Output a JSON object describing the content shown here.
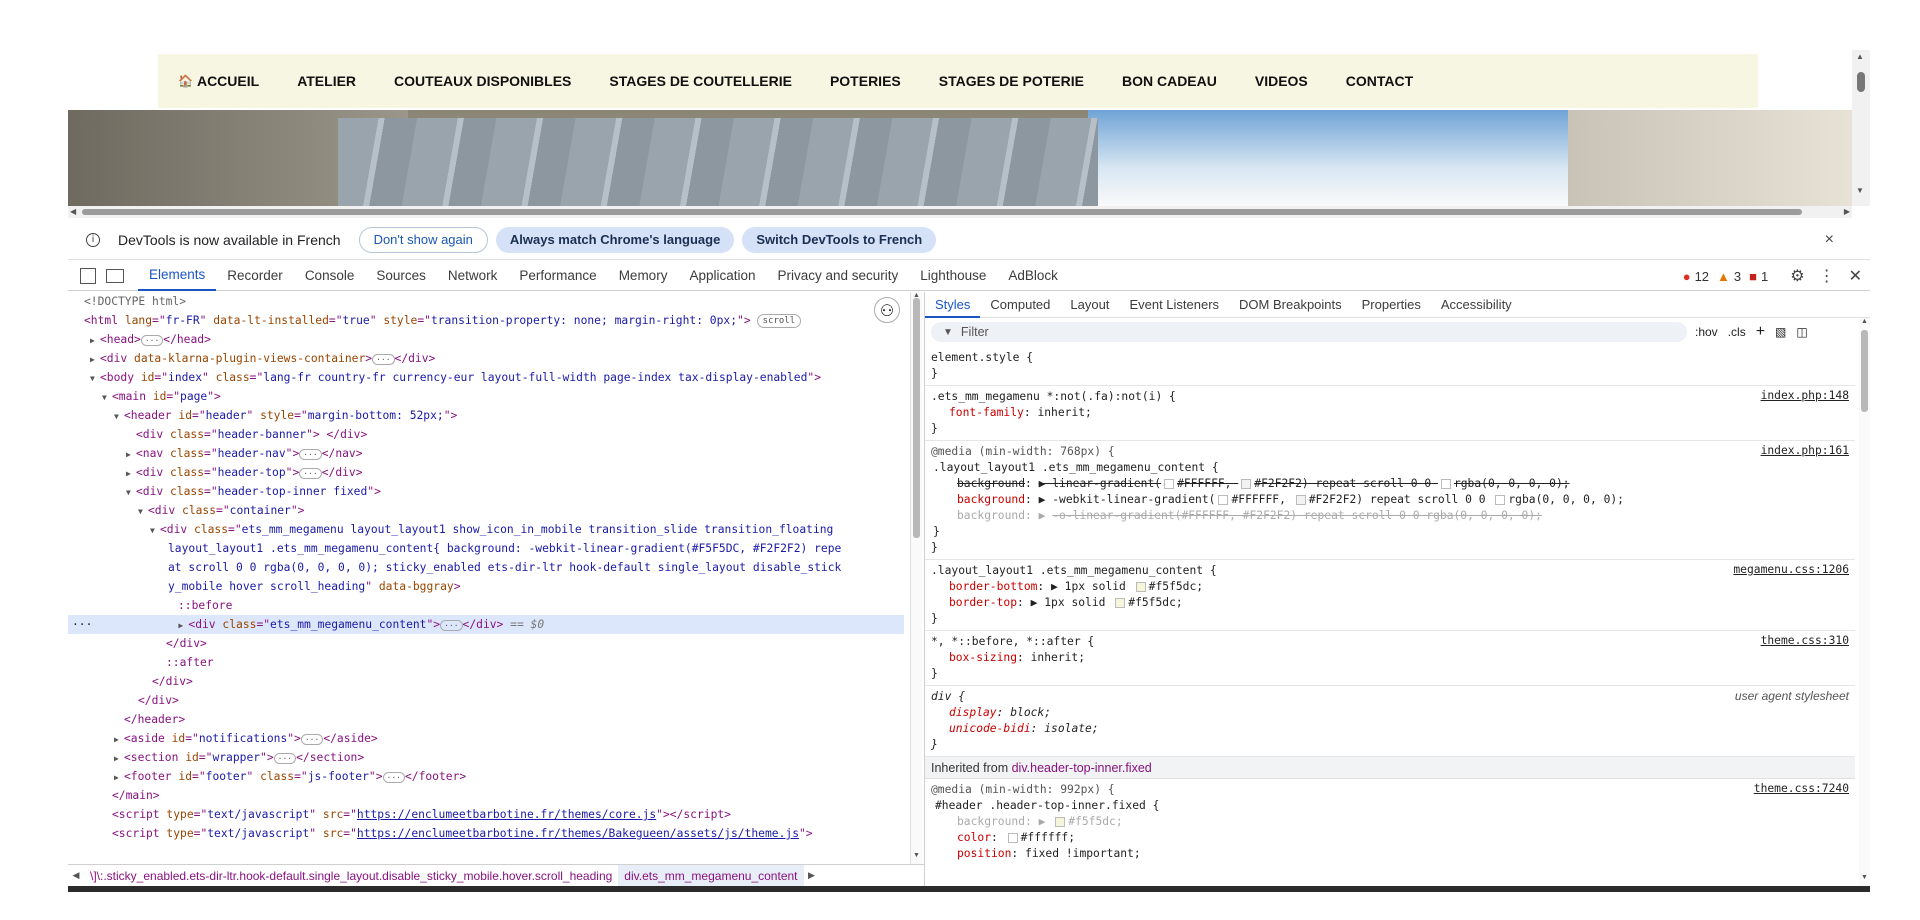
{
  "site": {
    "nav": [
      "ACCUEIL",
      "ATELIER",
      "COUTEAUX DISPONIBLES",
      "STAGES DE COUTELLERIE",
      "POTERIES",
      "STAGES DE POTERIE",
      "BON CADEAU",
      "VIDEOS",
      "CONTACT"
    ]
  },
  "infobar": {
    "message": "DevTools is now available in French",
    "dont_show": "Don't show again",
    "match_lang": "Always match Chrome's language",
    "switch": "Switch DevTools to French",
    "close": "×"
  },
  "devtools": {
    "tabs": [
      "Elements",
      "Recorder",
      "Console",
      "Sources",
      "Network",
      "Performance",
      "Memory",
      "Application",
      "Privacy and security",
      "Lighthouse",
      "AdBlock"
    ],
    "active_tab": "Elements",
    "errors": "12",
    "warnings": "3",
    "issues": "1"
  },
  "elements": {
    "l1": "<!DOCTYPE html>",
    "html_lang": "fr-FR",
    "html_lt": "true",
    "html_style": "transition-property: none; margin-right: 0px;",
    "scroll_badge": "scroll",
    "klarna": "data-klarna-plugin-views-container",
    "body_id": "index",
    "body_class": "lang-fr country-fr currency-eur layout-full-width page-index tax-display-enabled",
    "main_id": "page",
    "header_id": "header",
    "header_style": "margin-bottom: 52px;",
    "banner_class": "header-banner",
    "nav_class": "header-nav",
    "top_class": "header-top",
    "top_inner_class": "header-top-inner fixed",
    "container_class": "container",
    "megamenu_line1": "ets_mm_megamenu layout_layout1 show_icon_in_mobile transition_slide transition_floating",
    "megamenu_line2": "layout_layout1 .ets_mm_megamenu_content{ background: -webkit-linear-gradient(#F5F5DC, #F2F2F2) repe",
    "megamenu_line3": "at scroll 0 0 rgba(0, 0, 0, 0); sticky_enabled ets-dir-ltr hook-default single_layout disable_stick",
    "megamenu_line4": "y_mobile hover scroll_heading",
    "databg": "data-bggray",
    "before": "::before",
    "content_class": "ets_mm_megamenu_content",
    "dollar": "== $0",
    "after": "::after",
    "aside_id": "notifications",
    "section_id": "wrapper",
    "footer_id": "footer",
    "footer_class": "js-footer",
    "script1_src": "https://enclumeetbarbotine.fr/themes/core.js",
    "script2_src": "https://enclumeetbarbotine.fr/themes/Bakegueen/assets/js/theme.js"
  },
  "breadcrumb": {
    "left": "\\]\\:.sticky_enabled.ets-dir-ltr.hook-default.single_layout.disable_sticky_mobile.hover.scroll_heading",
    "active": "div.ets_mm_megamenu_content"
  },
  "styles": {
    "tabs": [
      "Styles",
      "Computed",
      "Layout",
      "Event Listeners",
      "DOM Breakpoints",
      "Properties",
      "Accessibility"
    ],
    "filter_placeholder": "Filter",
    "hov": ":hov",
    "cls": ".cls",
    "element_style": "element.style {",
    "rule1_sel": ".ets_mm_megamenu *:not(.fa):not(i) {",
    "rule1_prop": "font-family",
    "rule1_val": "inherit;",
    "rule1_src": "index.php:148",
    "rule2_media": "@media (min-width: 768px) {",
    "rule2_sel": ".layout_layout1 .ets_mm_megamenu_content {",
    "rule2_src": "index.php:161",
    "rule2_p1": "background",
    "rule2_v1a": "linear-gradient(",
    "rule2_v1b": "#FFFFFF,",
    "rule2_v1c": "#F2F2F2) repeat scroll 0 0",
    "rule2_v1d": "rgba(0, 0, 0, 0);",
    "rule2_v2a": "-webkit-linear-gradient(",
    "rule2_v2b": "#FFFFFF,",
    "rule2_v2c": "#F2F2F2) repeat scroll 0 0",
    "rule2_v2d": "rgba(0, 0, 0, 0);",
    "rule2_v3": "-o-linear-gradient(#FFFFFF, #F2F2F2) repeat scroll 0 0 rgba(0, 0, 0, 0);",
    "rule3_sel": ".layout_layout1 .ets_mm_megamenu_content {",
    "rule3_src": "megamenu.css:1206",
    "rule3_p1": "border-bottom",
    "rule3_v1": "1px solid",
    "rule3_c1": "#f5f5dc;",
    "rule3_p2": "border-top",
    "rule3_v2": "1px solid",
    "rule3_c2": "#f5f5dc;",
    "rule4_sel": "*, *::before, *::after {",
    "rule4_src": "theme.css:310",
    "rule4_prop": "box-sizing",
    "rule4_val": "inherit;",
    "rule5_sel": "div {",
    "rule5_src": "user agent stylesheet",
    "rule5_p1": "display",
    "rule5_v1": "block;",
    "rule5_p2": "unicode-bidi",
    "rule5_v2": "isolate;",
    "inherited_label": "Inherited from",
    "inherited_cls": "div.header-top-inner.fixed",
    "rule6_media": "@media (min-width: 992px) {",
    "rule6_sel": "#header .header-top-inner.fixed {",
    "rule6_src": "theme.css:7240",
    "rule6_p1": "background",
    "rule6_v1": "#f5f5dc;",
    "rule6_p2": "color",
    "rule6_v2": "#ffffff;",
    "rule6_p3": "position",
    "rule6_v3": "fixed !important;"
  },
  "colors": {
    "accent": "#1a56c3",
    "tag": "#881280",
    "attr_name": "#994500",
    "attr_value": "#1a1aa6",
    "nav_bg": "#f7f6e3"
  }
}
